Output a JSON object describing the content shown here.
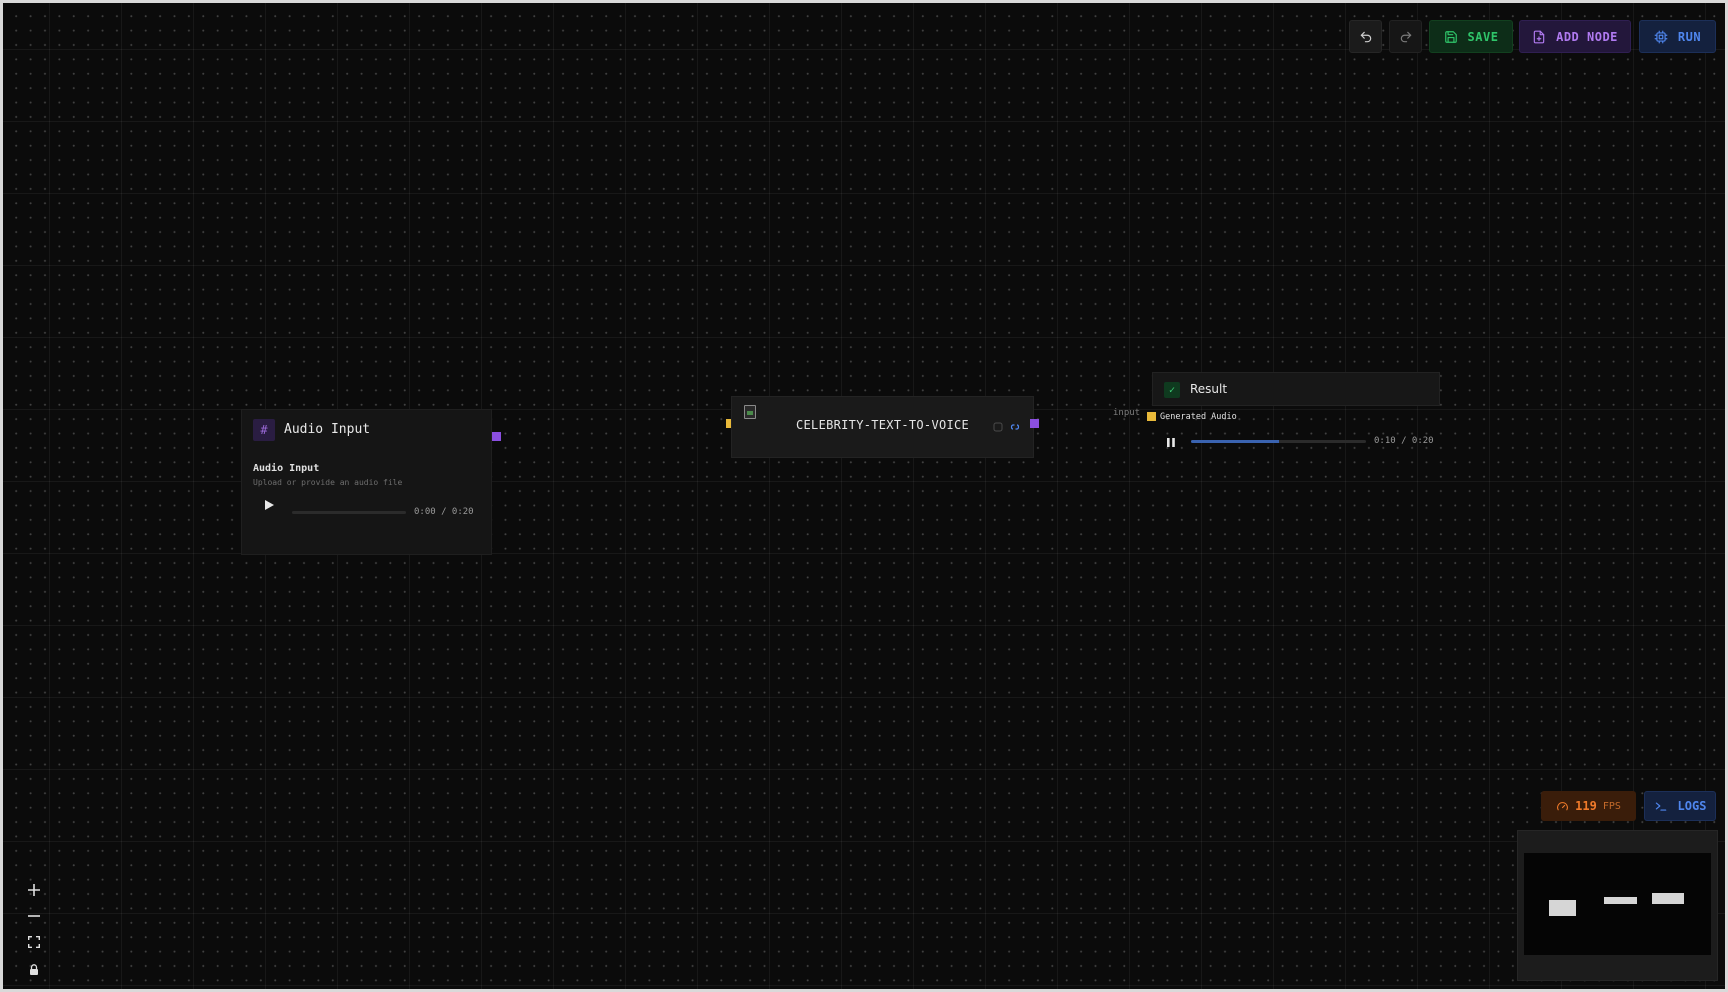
{
  "toolbar": {
    "undo_icon": "undo-icon",
    "redo_icon": "redo-icon",
    "save_label": "SAVE",
    "add_node_label": "ADD NODE",
    "run_label": "RUN"
  },
  "nodes": {
    "audio_input": {
      "title": "Audio Input",
      "field_label": "Audio Input",
      "field_description": "Upload or provide an audio file",
      "time": "0:00 / 0:20",
      "progress": 0,
      "output_port_color": "#8b4fe0"
    },
    "celebrity": {
      "title": "CELEBRITY-TEXT-TO-VOICE",
      "input_port_color": "#e8b93a",
      "output_port_color": "#8b4fe0"
    },
    "result": {
      "title": "Result",
      "input_label": "input",
      "output_label": "Generated Audio",
      "time": "0:10 / 0:20",
      "progress": 0.5,
      "port_color": "#e8b93a"
    }
  },
  "status": {
    "fps_value": "119",
    "fps_unit": "FPS",
    "logs_label": "LOGS"
  },
  "controls": [
    "zoom-in-icon",
    "zoom-out-icon",
    "fit-view-icon",
    "lock-icon"
  ],
  "colors": {
    "canvas_bg": "#0b0b0b",
    "save": "#2fc56a",
    "add_node": "#b07af0",
    "run": "#4f86ee",
    "fps": "#f07a2a"
  }
}
